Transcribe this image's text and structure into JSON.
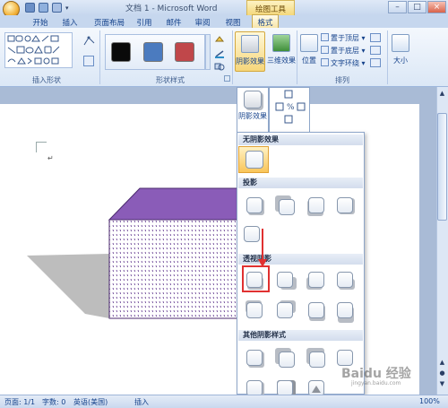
{
  "title_bar": {
    "document_title": "文档 1 - Microsoft Word",
    "context_tab": "绘图工具",
    "window_buttons": [
      "–",
      "□",
      "×"
    ]
  },
  "tabs": [
    "开始",
    "插入",
    "页面布局",
    "引用",
    "邮件",
    "审阅",
    "视图",
    "格式"
  ],
  "ribbon": {
    "insert_shapes_label": "插入形状",
    "shape_styles_label": "形状样式",
    "shadow_effects_button": "阴影效果",
    "threed_effects_button": "三维效果",
    "position_button": "位置",
    "bring_to_front": "置于顶层",
    "send_to_back": "置于底层",
    "text_wrap": "文字环绕",
    "arrange_label": "排列",
    "size_button": "大小",
    "swatch_colors": [
      "#0a0a0a",
      "#4b7bbf",
      "#c0474a"
    ]
  },
  "dropdown": {
    "shadow_effects_label": "阴影效果",
    "no_shadow": "无阴影效果",
    "drop_shadow": "投影",
    "perspective_shadow": "透视阴影",
    "other_shadow_styles": "其他阴影样式"
  },
  "document": {
    "shape_fill": "#8a5cb8",
    "paragraph_mark": "↵"
  },
  "status_bar": {
    "page": "页面: 1/1",
    "words": "字数: 0",
    "language": "英语(美国)",
    "mode": "插入",
    "zoom": "100%"
  },
  "watermark": "Baidu 经验",
  "watermark_url": "jingyan.baidu.com"
}
